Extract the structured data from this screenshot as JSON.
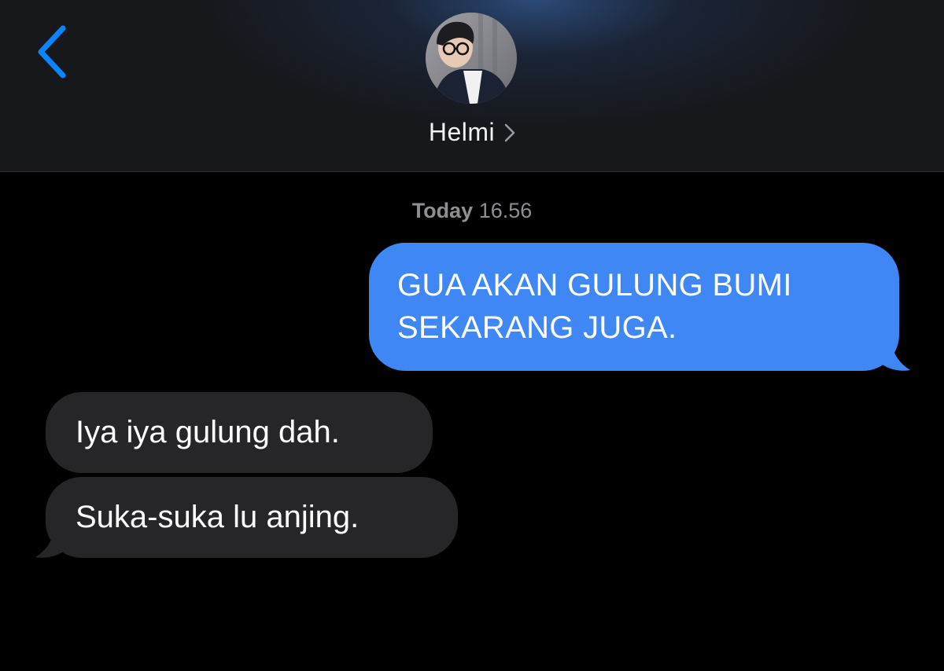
{
  "header": {
    "contact_name": "Helmi",
    "back_icon": "chevron-left-icon",
    "name_chevron_icon": "chevron-right-icon",
    "accent_color": "#0a84ff"
  },
  "conversation": {
    "timestamp_day": "Today",
    "timestamp_time": "16.56",
    "messages": [
      {
        "direction": "outgoing",
        "lines": [
          "GUA AKAN GULUNG BUMI",
          "SEKARANG JUGA."
        ],
        "color": "#3f87f5"
      },
      {
        "direction": "incoming",
        "text": "Iya iya gulung dah.",
        "color": "#262628"
      },
      {
        "direction": "incoming",
        "text": "Suka-suka lu anjing.",
        "color": "#262628"
      }
    ]
  }
}
